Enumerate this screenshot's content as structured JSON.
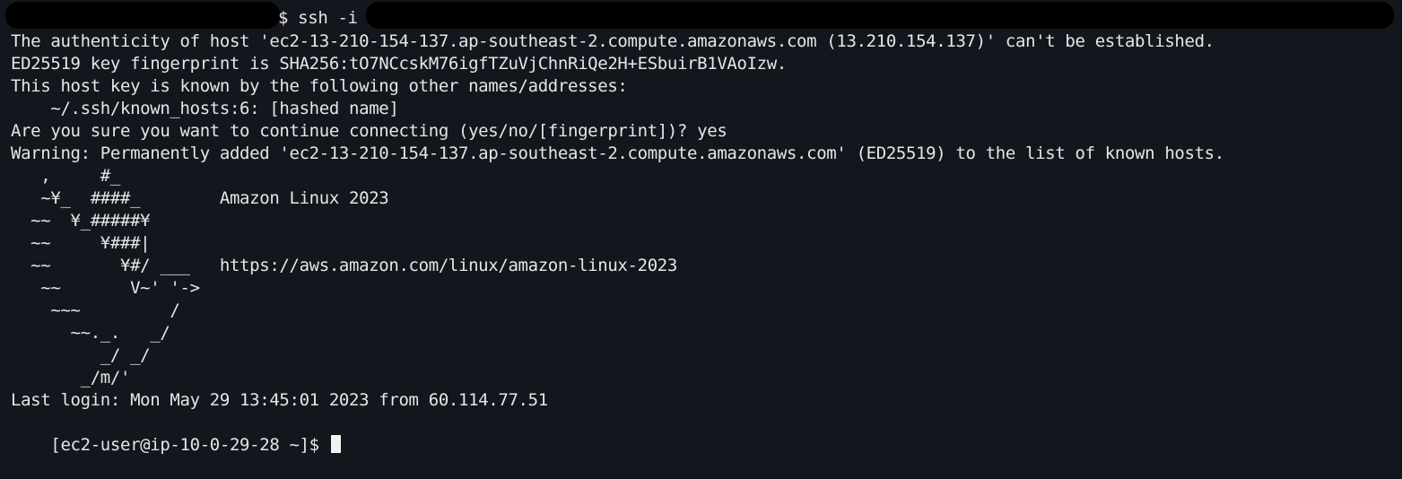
{
  "terminal": {
    "command_prefix": "$ ssh -i",
    "lines": [
      "The authenticity of host 'ec2-13-210-154-137.ap-southeast-2.compute.amazonaws.com (13.210.154.137)' can't be established.",
      "ED25519 key fingerprint is SHA256:tO7NCcskM76igfTZuVjChnRiQe2H+ESbuirB1VAoIzw.",
      "This host key is known by the following other names/addresses:",
      "    ~/.ssh/known_hosts:6: [hashed name]",
      "Are you sure you want to continue connecting (yes/no/[fingerprint])? yes",
      "Warning: Permanently added 'ec2-13-210-154-137.ap-southeast-2.compute.amazonaws.com' (ED25519) to the list of known hosts."
    ],
    "motd": {
      "art_1": "   ,     #_",
      "art_2": "   ~¥_  ####_        Amazon Linux 2023",
      "art_3": "  ~~  ¥_#####¥",
      "art_4": "  ~~     ¥###|",
      "art_5": "  ~~       ¥#/ ___   https://aws.amazon.com/linux/amazon-linux-2023",
      "art_6": "   ~~       V~' '->",
      "art_7": "    ~~~         /",
      "art_8": "      ~~._.   _/",
      "art_9": "         _/ _/",
      "art_10": "       _/m/'"
    },
    "last_login": "Last login: Mon May 29 13:45:01 2023 from 60.114.77.51",
    "prompt": "[ec2-user@ip-10-0-29-28 ~]$ "
  }
}
